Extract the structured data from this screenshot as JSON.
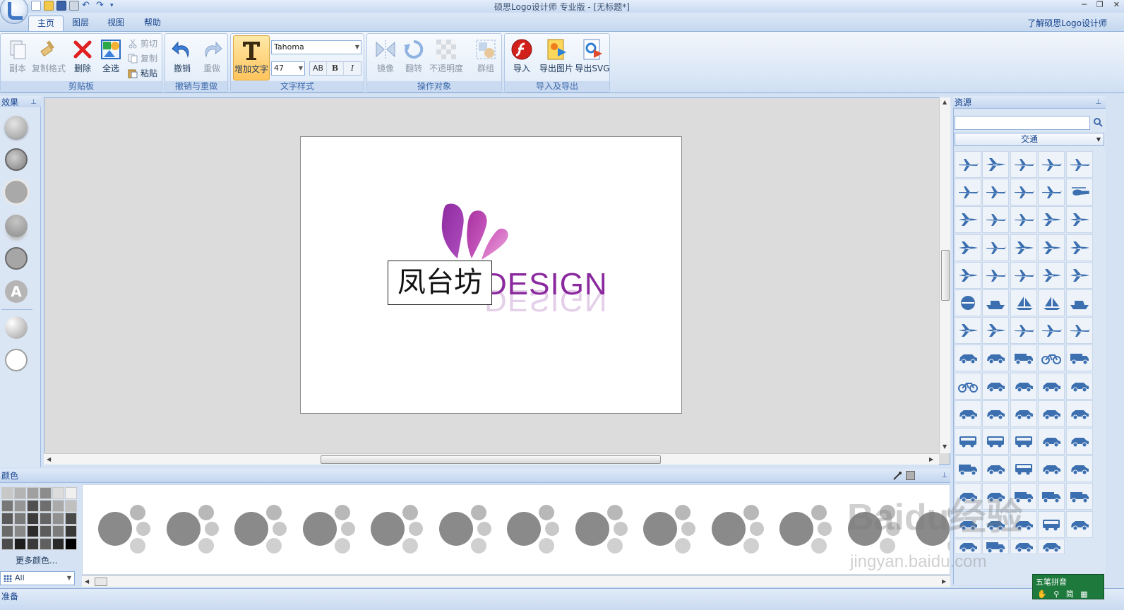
{
  "window": {
    "title": "硕思Logo设计师 专业版 - [无标题*]",
    "min": "─",
    "restore": "❐",
    "close": "✕"
  },
  "menu": {
    "tabs": [
      "主页",
      "图层",
      "视图",
      "帮助"
    ],
    "about": "了解硕思Logo设计师"
  },
  "ribbon": {
    "clipboard": {
      "label": "剪贴板",
      "duplicate": "副本",
      "format_painter": "复制格式",
      "delete": "删除",
      "select_all": "全选",
      "cut": "剪切",
      "copy": "复制",
      "paste": "粘贴"
    },
    "undo_group": {
      "label": "撤销与重做",
      "undo": "撤销",
      "redo": "重做"
    },
    "text_style": {
      "label": "文字样式",
      "add_text": "增加文字",
      "font": "Tahoma",
      "size": "47",
      "spacing": "AB",
      "bold": "B",
      "italic": "I"
    },
    "operate": {
      "label": "操作对象",
      "mirror": "镜像",
      "rotate": "翻转",
      "opacity": "不透明度",
      "group": "群组"
    },
    "import_export": {
      "label": "导入及导出",
      "import": "导入",
      "export_image": "导出图片",
      "export_svg": "导出SVG"
    }
  },
  "effects_panel": {
    "title": "效果"
  },
  "canvas": {
    "logo_text": "DESIGN",
    "text_box": "凤台坊"
  },
  "resources": {
    "title": "资源",
    "search_value": "",
    "category": "交通"
  },
  "colors": {
    "title": "颜色",
    "more": "更多颜色...",
    "filter": "All"
  },
  "status": {
    "text": "准备"
  },
  "ime": {
    "name": "五笔拼音",
    "mode": "简"
  },
  "watermark": {
    "logo": "Baidu经验",
    "url": "jingyan.baidu.com"
  },
  "palette": [
    "#c8c8c8",
    "#b4b4b4",
    "#a0a0a0",
    "#8c8c8c",
    "#dcdcdc",
    "#f0f0f0",
    "#787878",
    "#969696",
    "#505050",
    "#6e6e6e",
    "#aaaaaa",
    "#c0c0c0",
    "#5a5a5a",
    "#7a7a7a",
    "#3c3c3c",
    "#646464",
    "#909090",
    "#4a4a4a",
    "#6a6a6a",
    "#888888",
    "#2c2c2c",
    "#5c5c5c",
    "#7c7c7c",
    "#383838",
    "#4c4c4c",
    "#1e1e1e",
    "#3a3a3a",
    "#606060",
    "#2a2a2a",
    "#000000"
  ],
  "colors_accent": {
    "logo_purple": "#8a2a9e",
    "icon_blue": "#3b6fb0"
  }
}
